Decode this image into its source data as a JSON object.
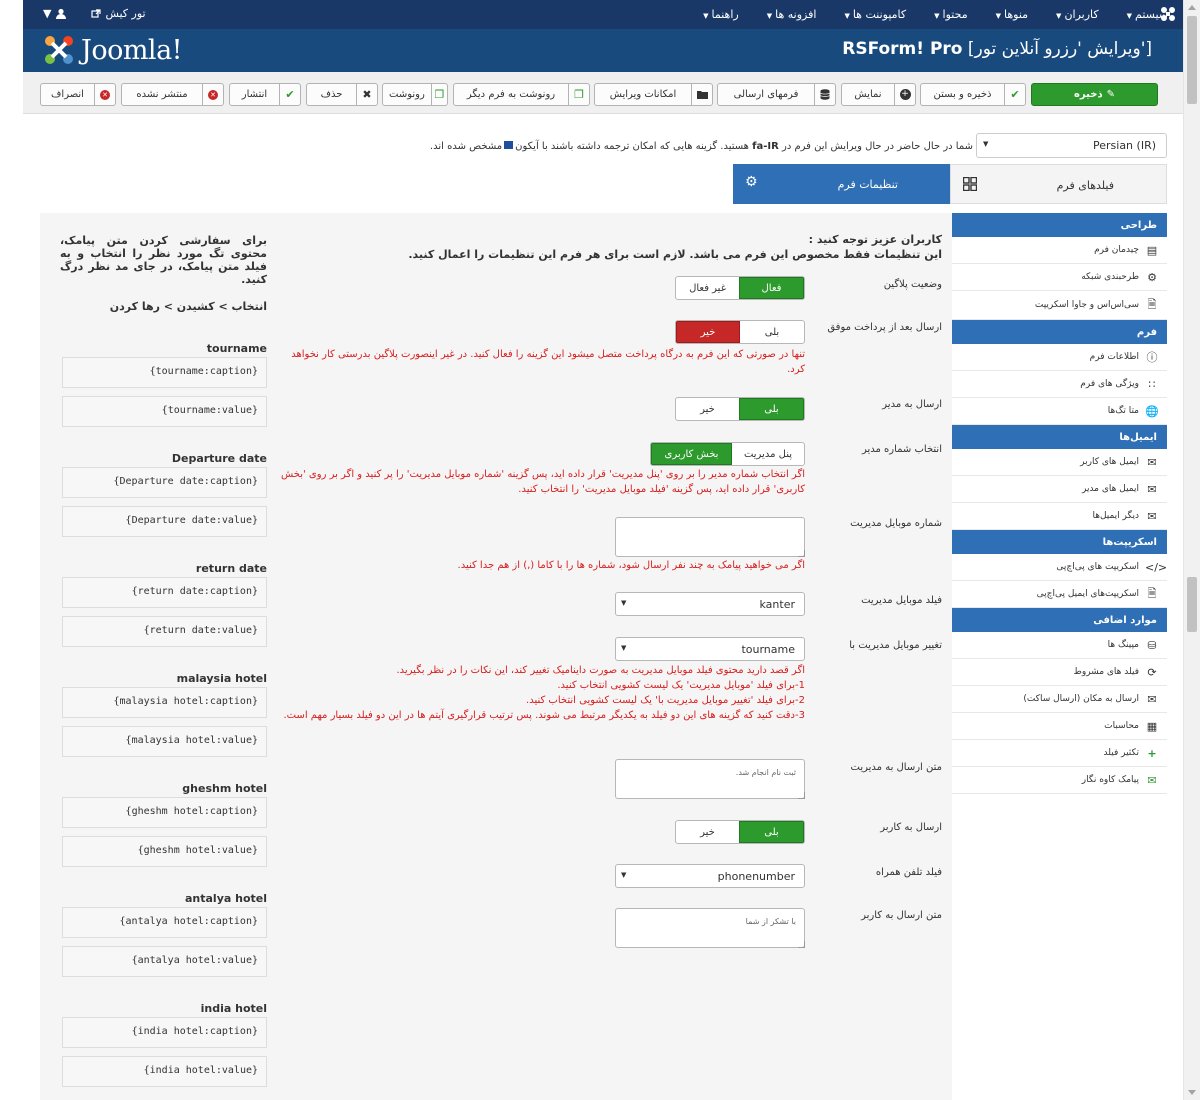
{
  "topnav": {
    "menu": [
      {
        "label": "سیستم"
      },
      {
        "label": "کاربران"
      },
      {
        "label": "منوها"
      },
      {
        "label": "محتوا"
      },
      {
        "label": "کامپوننت ها"
      },
      {
        "label": "افزونه ها"
      },
      {
        "label": "راهنما"
      }
    ],
    "site_link": "تور کیش"
  },
  "header": {
    "title_brand": "RSForm! Pro",
    "title_rest": "[ویرایش 'رزرو آنلاین تور']",
    "logo_text": "Joomla!"
  },
  "toolbar": {
    "save": "ذخیره",
    "save_close": "ذخیره و بستن",
    "preview": "نمایش",
    "submissions": "فرمهای ارسالی",
    "edit_options": "امکانات ویرایش",
    "copy_other": "رونوشت به فرم دیگر",
    "copy": "رونوشت",
    "delete": "حذف",
    "publish": "انتشار",
    "unpublish": "منتشر نشده",
    "cancel": "انصراف"
  },
  "language": {
    "selected": "Persian (IR)",
    "note_before": "شما در حال حاضر در حال ویرایش این فرم در",
    "note_code": "fa-IR",
    "note_after": "هستید. گزینه هایی که امکان ترجمه داشته باشند با آیکون",
    "note_end": "مشخص شده اند."
  },
  "tabs": {
    "fields": "فیلدهای فرم",
    "settings": "تنظیمات فرم"
  },
  "sidebar": {
    "sections": [
      {
        "title": "طراحی",
        "items": [
          "چیدمان فرم",
          "طرحبندی شبکه",
          "سی‌اس‌اس و جاوا اسکریپت"
        ]
      },
      {
        "title": "فرم",
        "items": [
          "اطلاعات فرم",
          "ویژگی های فرم",
          "متا تگ‌ها"
        ]
      },
      {
        "title": "ایمیل‌ها",
        "items": [
          "ایمیل های کاربر",
          "ایمیل های مدیر",
          "دیگر ایمیل‌ها"
        ]
      },
      {
        "title": "اسکریپت‌ها",
        "items": [
          "اسکریپت های پی‌اچ‌پی",
          "اسکریپت‌های ایمیل پی‌اچ‌پی"
        ]
      },
      {
        "title": "موارد اضافی",
        "items": [
          "مپینگ ها",
          "فیلد های مشروط",
          "ارسال به مکان (ارسال ساکت)",
          "محاسبات",
          "تکثیر فیلد",
          "پیامک کاوه نگار"
        ]
      }
    ]
  },
  "notice": {
    "line1": "کاربران عزیز توجه کنید :",
    "line2": "این تنظیمات فقط مخصوص این فرم می باشد. لازم است برای هر فرم این تنظیمات را اعمال کنید."
  },
  "settings": {
    "plugin_status": {
      "label": "وضعیت پلاگین",
      "on": "فعال",
      "off": "غیر فعال"
    },
    "send_after_payment": {
      "label": "ارسال بعد از پرداخت موفق",
      "yes": "بلی",
      "no": "خیر",
      "help": "تنها در صورتی که این فرم به درگاه پرداخت متصل میشود این گزینه را فعال کنید. در غیر اینصورت پلاگین بدرستی کار نخواهد کرد."
    },
    "send_to_admin": {
      "label": "ارسال به مدیر",
      "yes": "بلی",
      "no": "خیر"
    },
    "admin_number": {
      "label": "انتخاب شماره مدیر",
      "panel": "پنل مدیریت",
      "user": "بخش کاربری",
      "help": "اگر انتخاب شماره مدیر را بر روی 'پنل مدیریت' قرار داده اید، پس گزینه 'شماره موبایل مدیریت' را پر کنید و اگر بر روی 'بخش کاربری' قرار داده اید، پس گزینه 'فیلد موبایل مدیریت' را انتخاب کنید."
    },
    "admin_mobile": {
      "label": "شماره موبایل مدیریت",
      "help": "اگر می خواهید پیامک به چند نفر ارسال شود، شماره ها را با کاما (,) از هم جدا کنید."
    },
    "admin_mobile_field": {
      "label": "فیلد موبایل مدیریت",
      "value": "kanter"
    },
    "change_admin_mobile": {
      "label": "تغییر موبایل مدیریت با",
      "value": "tourname",
      "help1": "اگر قصد دارید محتوی فیلد موبایل مدیریت به صورت داینامیک تغییر کند، این نکات را در نظر بگیرید.",
      "help2": "1-برای فیلد 'موبایل مدیریت' یک لیست کشویی انتخاب کنید.",
      "help3": "2-برای فیلد 'تغییر موبایل مدیریت با' یک لیست کشویی انتخاب کنید.",
      "help4": "3-دقت کنید که گزینه های این دو فیلد به یکدیگر مرتبط می شوند. پس ترتیب قرارگیری آیتم ها در این دو فیلد بسیار مهم است."
    },
    "admin_text": {
      "label": "متن ارسال به مدیریت",
      "value": "ثبت نام انجام شد."
    },
    "send_to_user": {
      "label": "ارسال به کاربر",
      "yes": "بلی",
      "no": "خیر"
    },
    "phone_field": {
      "label": "فیلد تلفن همراه",
      "value": "phonenumber"
    },
    "user_text": {
      "label": "متن ارسال به کاربر",
      "value": "با تشکر از شما"
    }
  },
  "placeholders_panel": {
    "instructions": "برای سفارشی کردن متن پیامک، محتوی تگ مورد نظر را انتخاب و به فیلد متن پیامک، در جای مد نظر درگ کنید.",
    "steps": "انتخاب > کشیدن > رها کردن",
    "fields": [
      {
        "name": "tourname",
        "caption": "{tourname:caption}",
        "value": "{tourname:value}"
      },
      {
        "name": "Departure date",
        "caption": "{Departure date:caption}",
        "value": "{Departure date:value}"
      },
      {
        "name": "return date",
        "caption": "{return date:caption}",
        "value": "{return date:value}"
      },
      {
        "name": "malaysia hotel",
        "caption": "{malaysia hotel:caption}",
        "value": "{malaysia hotel:value}"
      },
      {
        "name": "gheshm hotel",
        "caption": "{gheshm hotel:caption}",
        "value": "{gheshm hotel:value}"
      },
      {
        "name": "antalya hotel",
        "caption": "{antalya hotel:caption}",
        "value": "{antalya hotel:value}"
      },
      {
        "name": "india hotel",
        "caption": "{india hotel:caption}",
        "value": "{india hotel:value}"
      }
    ]
  },
  "colors": {
    "navbar": "#1a3867",
    "header": "#184a7d",
    "accent": "#2e6fb5",
    "success": "#2d9a2d",
    "danger": "#c52827",
    "error_text": "#d81e1e"
  }
}
